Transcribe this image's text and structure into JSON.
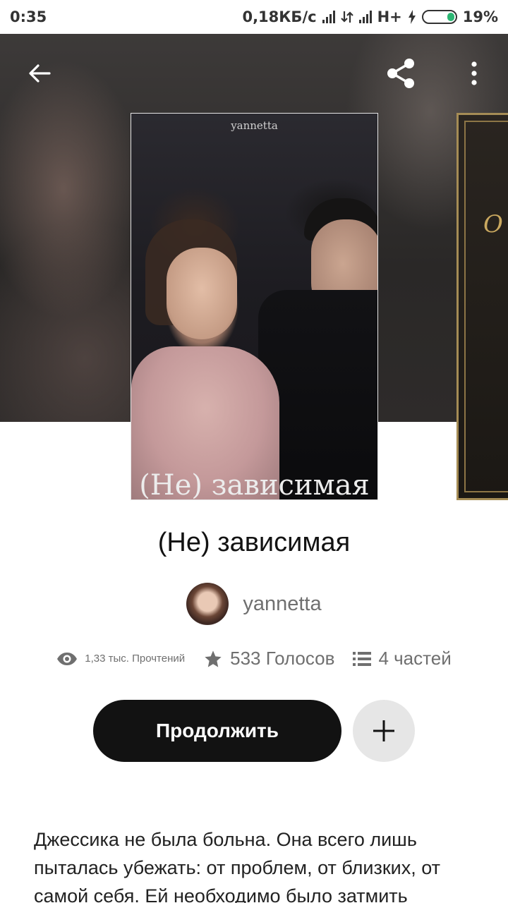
{
  "status_bar": {
    "time": "0:35",
    "network_speed": "0,18КБ/с",
    "network_type": "H+",
    "battery": "19%"
  },
  "toolbar": {
    "back_icon": "arrow-left-icon",
    "share_icon": "share-icon",
    "more_icon": "more-vertical-icon"
  },
  "cover": {
    "author": "yannetta",
    "title": "(Не) зависимая"
  },
  "next_cover": {
    "partial_text": "O"
  },
  "book": {
    "title": "(Не) зависимая",
    "author": "yannetta",
    "stats": {
      "reads": "1,33 тыс. Прочтений",
      "votes": "533 Голосов",
      "parts": "4 частей"
    }
  },
  "actions": {
    "continue_label": "Продолжить",
    "add_icon": "plus-icon"
  },
  "description": "Джессика не была больна. Она всего лишь пыталась убежать: от проблем, от близких, от самой себя. Ей необходимо было затмить",
  "colors": {
    "primary_button": "#121212",
    "secondary_button": "#e6e6e6",
    "muted_text": "#6f6f6f",
    "battery_level": "#2bb673"
  }
}
